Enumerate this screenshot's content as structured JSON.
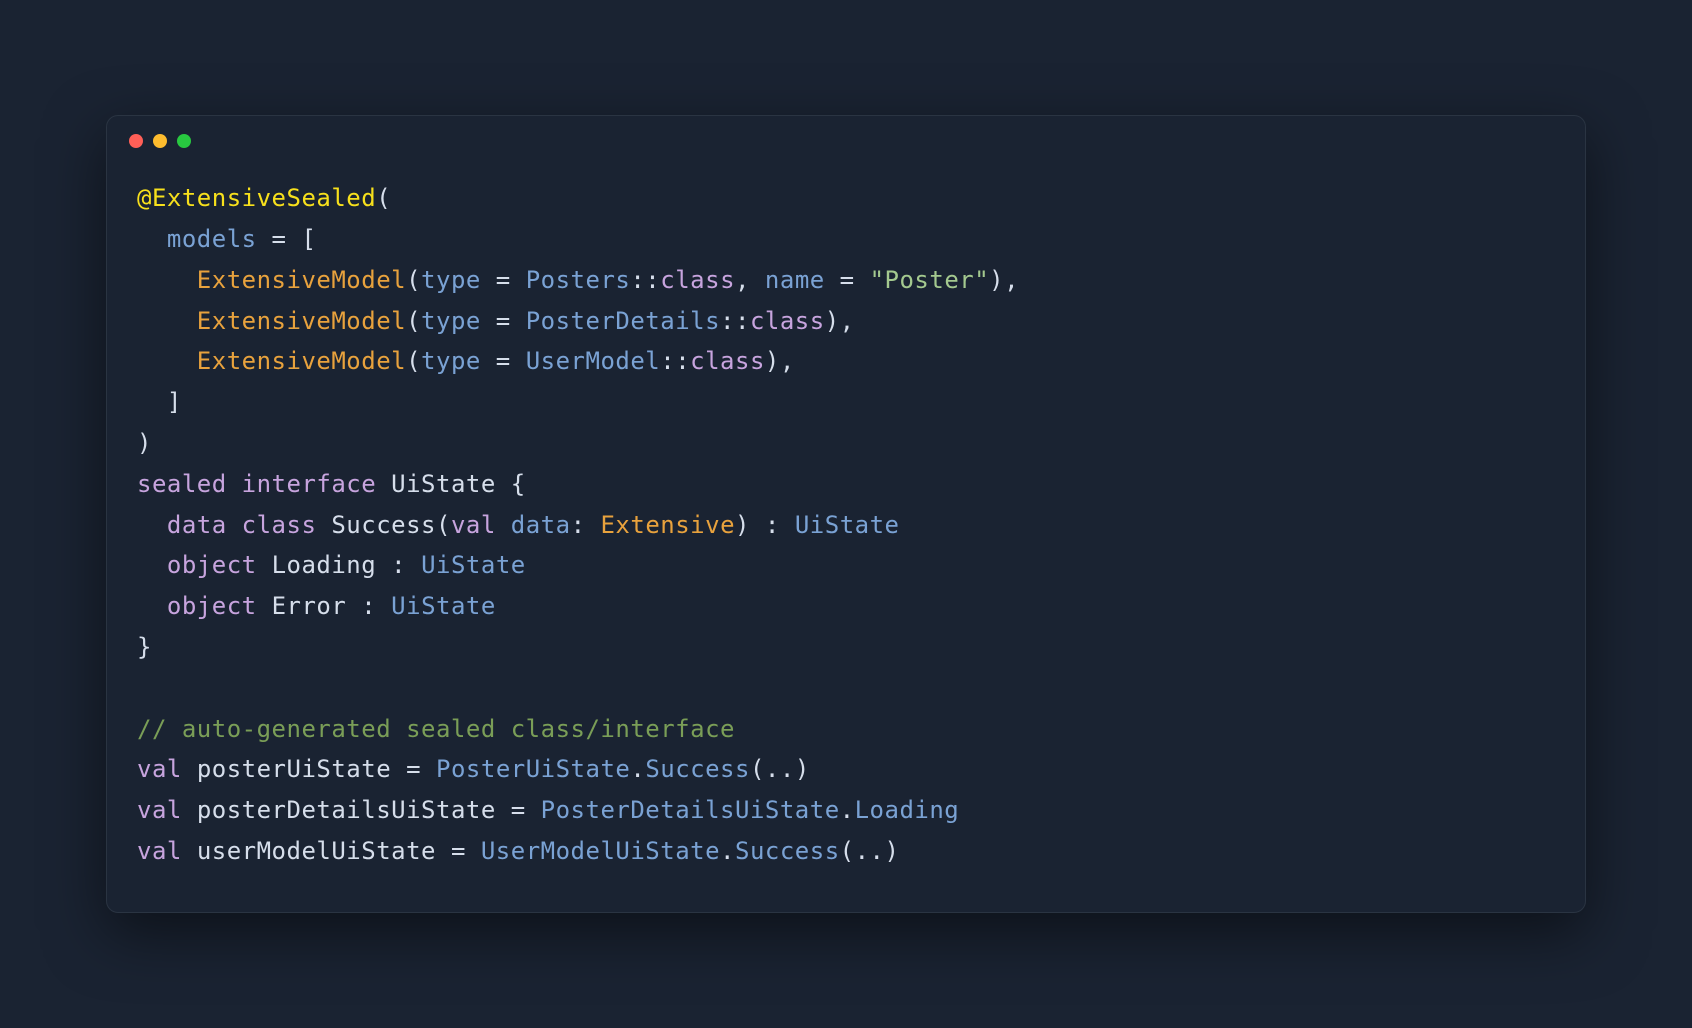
{
  "colors": {
    "background": "#1a2332",
    "annotation": "#f7e01c",
    "param": "#7aa2d4",
    "class": "#e8a23d",
    "member": "#c7a4de",
    "string": "#a4c98f",
    "keyword": "#c7a4de",
    "default": "#d6deeb",
    "comment": "#7a9e57"
  },
  "code": {
    "line1": {
      "annotation": "@ExtensiveSealed",
      "paren": "("
    },
    "line2": {
      "indent": "  ",
      "param": "models",
      "equals": " = [",
      "close": ""
    },
    "line3": {
      "indent": "    ",
      "class": "ExtensiveModel",
      "open": "(",
      "param1": "type",
      "eq1": " = ",
      "type1": "Posters",
      "colon1": "::",
      "member1": "class",
      "comma1": ", ",
      "param2": "name",
      "eq2": " = ",
      "str": "\"Poster\"",
      "close": "),"
    },
    "line4": {
      "indent": "    ",
      "class": "ExtensiveModel",
      "open": "(",
      "param1": "type",
      "eq1": " = ",
      "type1": "PosterDetails",
      "colon1": "::",
      "member1": "class",
      "close": "),"
    },
    "line5": {
      "indent": "    ",
      "class": "ExtensiveModel",
      "open": "(",
      "param1": "type",
      "eq1": " = ",
      "type1": "UserModel",
      "colon1": "::",
      "member1": "class",
      "close": "),"
    },
    "line6": {
      "indent": "  ",
      "close": "]"
    },
    "line7": {
      "close": ")"
    },
    "line8": {
      "kw1": "sealed",
      "sp1": " ",
      "kw2": "interface",
      "sp2": " ",
      "name": "UiState",
      "sp3": " ",
      "open": "{"
    },
    "line9": {
      "indent": "  ",
      "kw1": "data",
      "sp1": " ",
      "kw2": "class",
      "sp2": " ",
      "name": "Success",
      "open": "(",
      "kw3": "val",
      "sp3": " ",
      "param": "data",
      "colon": ": ",
      "ext": "Extensive",
      "close": ")",
      "sp4": " : ",
      "type": "UiState"
    },
    "line10": {
      "indent": "  ",
      "kw1": "object",
      "sp1": " ",
      "name": "Loading",
      "sp2": " : ",
      "type": "UiState"
    },
    "line11": {
      "indent": "  ",
      "kw1": "object",
      "sp1": " ",
      "name": "Error",
      "sp2": " : ",
      "type": "UiState"
    },
    "line12": {
      "close": "}"
    },
    "line13": {
      "blank": ""
    },
    "line14": {
      "comment": "// auto-generated sealed class/interface"
    },
    "line15": {
      "kw1": "val",
      "sp1": " ",
      "name": "posterUiState",
      "sp2": " = ",
      "type": "PosterUiState",
      "dot": ".",
      "member": "Success",
      "open": "(",
      "dots": "..",
      "close": ")"
    },
    "line16": {
      "kw1": "val",
      "sp1": " ",
      "name": "posterDetailsUiState",
      "sp2": " = ",
      "type": "PosterDetailsUiState",
      "dot": ".",
      "member": "Loading"
    },
    "line17": {
      "kw1": "val",
      "sp1": " ",
      "name": "userModelUiState",
      "sp2": " = ",
      "type": "UserModelUiState",
      "dot": ".",
      "member": "Success",
      "open": "(",
      "dots": "..",
      "close": ")"
    }
  }
}
